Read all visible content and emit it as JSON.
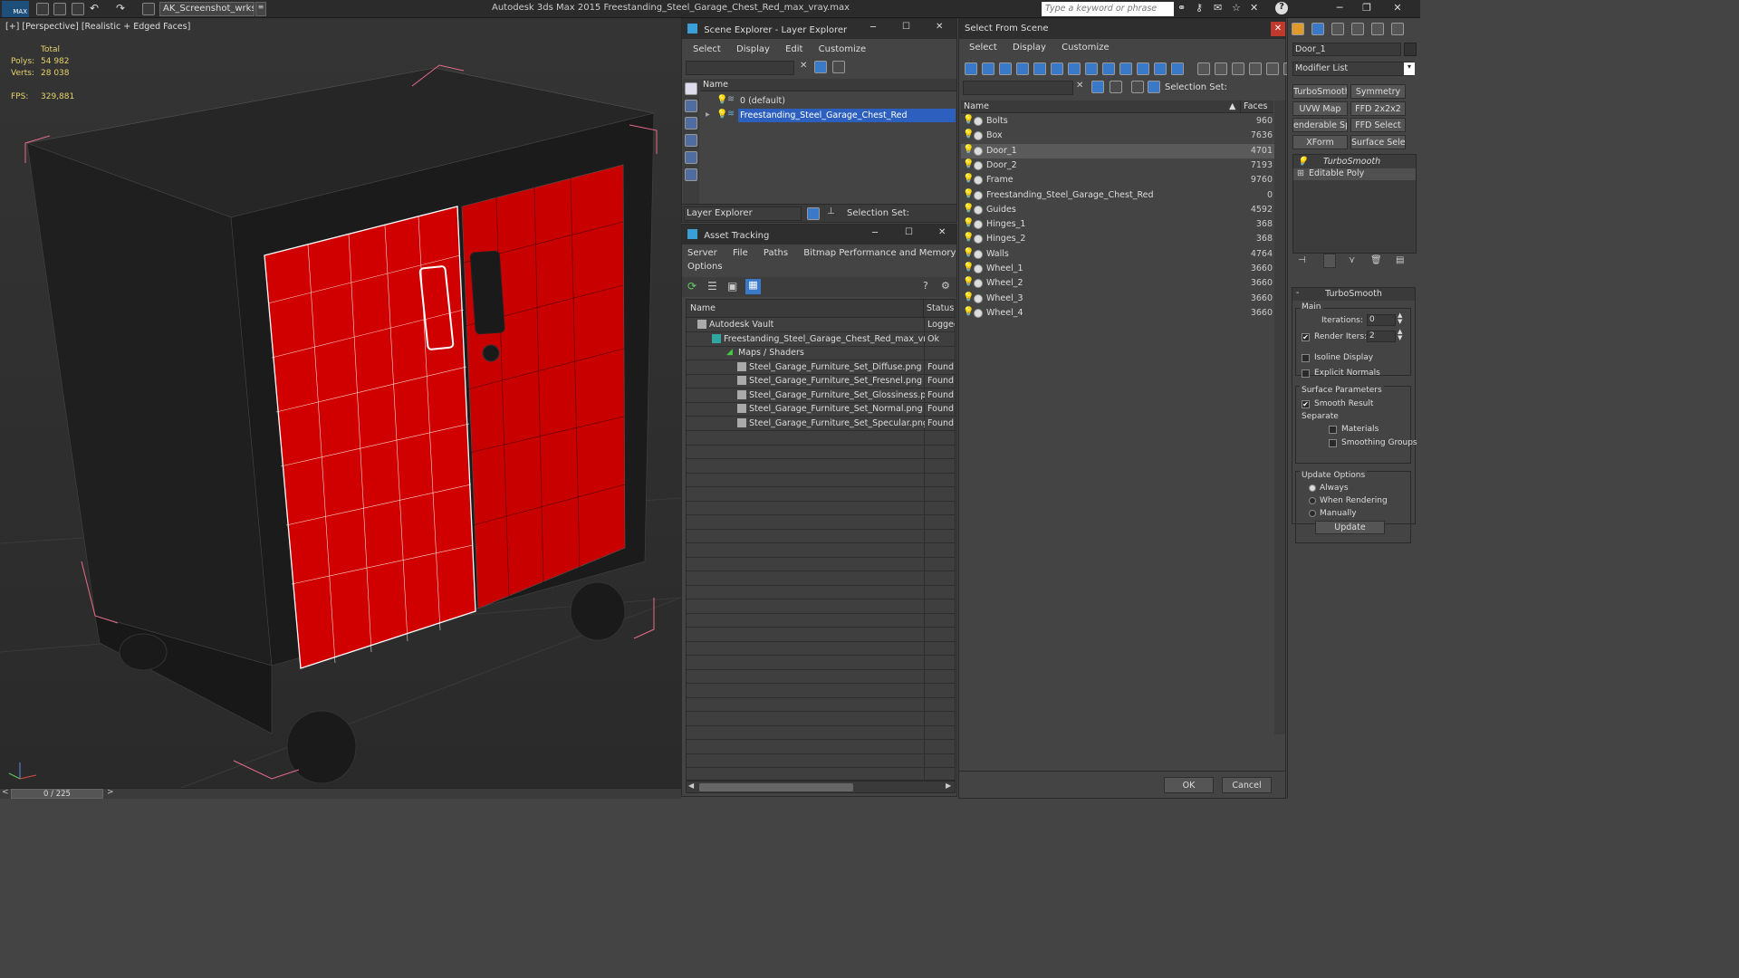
{
  "app": {
    "logo": "MAX",
    "workspace": "AK_Screenshot_wrksp",
    "title": "Autodesk 3ds Max  2015     Freestanding_Steel_Garage_Chest_Red_max_vray.max",
    "search_placeholder": "Type a keyword or phrase"
  },
  "viewport": {
    "label": "[+] [Perspective] [Realistic + Edged Faces]",
    "total_label": "Total",
    "polys_label": "Polys:",
    "polys": "54 982",
    "verts_label": "Verts:",
    "verts": "28 038",
    "fps_label": "FPS:",
    "fps": "329,881",
    "timeline": "0 / 225"
  },
  "scene_explorer": {
    "title": "Scene Explorer - Layer Explorer",
    "menu": [
      "Select",
      "Display",
      "Edit",
      "Customize"
    ],
    "col_name": "Name",
    "layers": [
      "0 (default)",
      "Freestanding_Steel_Garage_Chest_Red"
    ],
    "footer_dropdown": "Layer Explorer",
    "footer_selection": "Selection Set:"
  },
  "asset_tracking": {
    "title": "Asset Tracking",
    "menu": [
      "Server",
      "File",
      "Paths",
      "Bitmap Performance and Memory"
    ],
    "menu2": "Options",
    "col_name": "Name",
    "col_status": "Status",
    "rows": [
      {
        "name": "Autodesk Vault",
        "status": "Logged"
      },
      {
        "name": "Freestanding_Steel_Garage_Chest_Red_max_vra...",
        "status": "Ok"
      },
      {
        "name": "Maps / Shaders",
        "status": ""
      },
      {
        "name": "Steel_Garage_Furniture_Set_Diffuse.png",
        "status": "Found"
      },
      {
        "name": "Steel_Garage_Furniture_Set_Fresnel.png",
        "status": "Found"
      },
      {
        "name": "Steel_Garage_Furniture_Set_Glossiness.png",
        "status": "Found"
      },
      {
        "name": "Steel_Garage_Furniture_Set_Normal.png",
        "status": "Found"
      },
      {
        "name": "Steel_Garage_Furniture_Set_Specular.png",
        "status": "Found"
      }
    ]
  },
  "select_from_scene": {
    "title": "Select From Scene",
    "menu": [
      "Select",
      "Display",
      "Customize"
    ],
    "selection_set": "Selection Set:",
    "col_name": "Name",
    "col_faces": "Faces",
    "objects": [
      {
        "name": "Bolts",
        "faces": "960"
      },
      {
        "name": "Box",
        "faces": "7636"
      },
      {
        "name": "Door_1",
        "faces": "4701"
      },
      {
        "name": "Door_2",
        "faces": "7193"
      },
      {
        "name": "Frame",
        "faces": "9760"
      },
      {
        "name": "Freestanding_Steel_Garage_Chest_Red",
        "faces": "0"
      },
      {
        "name": "Guides",
        "faces": "4592"
      },
      {
        "name": "Hinges_1",
        "faces": "368"
      },
      {
        "name": "Hinges_2",
        "faces": "368"
      },
      {
        "name": "Walls",
        "faces": "4764"
      },
      {
        "name": "Wheel_1",
        "faces": "3660"
      },
      {
        "name": "Wheel_2",
        "faces": "3660"
      },
      {
        "name": "Wheel_3",
        "faces": "3660"
      },
      {
        "name": "Wheel_4",
        "faces": "3660"
      }
    ],
    "ok": "OK",
    "cancel": "Cancel"
  },
  "modify_panel": {
    "object_name": "Door_1",
    "modifier_list": "Modifier List",
    "buttons": [
      "TurboSmooth",
      "Symmetry",
      "UVW Map",
      "FFD 2x2x2",
      "enderable Splin",
      "FFD Select",
      "XForm",
      "Surface Select"
    ],
    "stack": [
      "TurboSmooth",
      "Editable Poly"
    ],
    "rollout_title": "TurboSmooth",
    "main_label": "Main",
    "iterations_label": "Iterations:",
    "iterations": "0",
    "render_iters_label": "Render Iters:",
    "render_iters": "2",
    "isoline": "Isoline Display",
    "explicit_normals": "Explicit Normals",
    "surface_params": "Surface Parameters",
    "smooth_result": "Smooth Result",
    "separate": "Separate",
    "materials": "Materials",
    "smoothing_groups": "Smoothing Groups",
    "update_options": "Update Options",
    "always": "Always",
    "when_rendering": "When Rendering",
    "manually": "Manually",
    "update_btn": "Update"
  }
}
